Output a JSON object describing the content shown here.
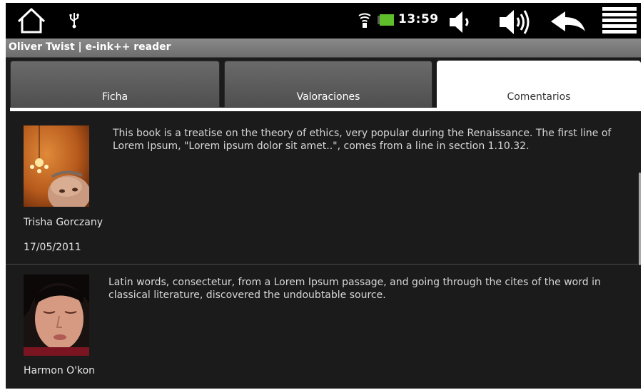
{
  "status_bar": {
    "time": "13:59",
    "icons": [
      "home-icon",
      "usb-icon",
      "wifi-icon",
      "battery-icon",
      "volume-down-icon",
      "volume-up-icon",
      "back-icon",
      "menu-icon"
    ]
  },
  "title_bar": {
    "title": "Oliver Twist | e-ink++ reader"
  },
  "tabs": [
    {
      "label": "Ficha",
      "selected": false
    },
    {
      "label": "Valoraciones",
      "selected": false
    },
    {
      "label": "Comentarios",
      "selected": true
    }
  ],
  "comments": [
    {
      "author": "Trisha Gorczany",
      "date": "17/05/2011",
      "text": "This book is a treatise on the theory of ethics, very popular during the Renaissance. The first line of Lorem Ipsum, \"Lorem ipsum dolor sit amet..\", comes from a line in section 1.10.32."
    },
    {
      "author": "Harmon O'kon",
      "text": "Latin words, consectetur, from a Lorem Ipsum passage, and going through the cites of the word in classical literature, discovered the undoubtable source."
    }
  ],
  "colors": {
    "background": "#1b1b1b",
    "status_bar": "#000000",
    "title_bar": "#7a7a7a",
    "selected_tab": "#ffffff",
    "text": "#e4e4e4"
  }
}
